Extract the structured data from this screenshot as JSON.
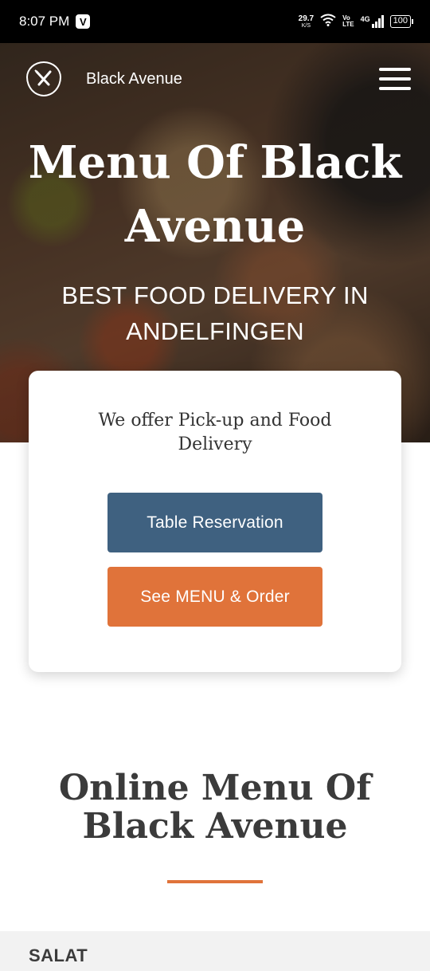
{
  "statusbar": {
    "time": "8:07 PM",
    "app_badge": "V",
    "netspeed_value": "29.7",
    "netspeed_unit": "K/S",
    "volte_line1": "Vo",
    "volte_line2": "LTE",
    "network_type": "4G",
    "battery": "100"
  },
  "navbar": {
    "brand": "Black Avenue"
  },
  "hero": {
    "title": "Menu Of Black Avenue",
    "subtitle": "BEST FOOD DELIVERY IN ANDELFINGEN"
  },
  "card": {
    "text": "We offer Pick-up and Food Delivery",
    "reserve_label": "Table Reservation",
    "menu_label": "See MENU & Order"
  },
  "section": {
    "title": "Online Menu Of Black Avenue"
  },
  "category": {
    "label": "SALAT"
  },
  "colors": {
    "accent": "#e0733a",
    "primary_button": "#3f6180"
  }
}
